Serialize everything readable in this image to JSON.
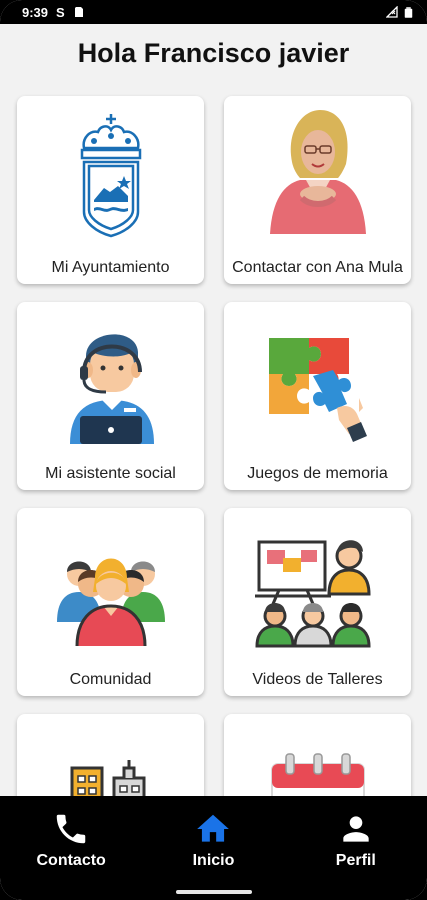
{
  "status_bar": {
    "time": "9:39",
    "s_glyph": "S"
  },
  "header": {
    "title": "Hola Francisco javier"
  },
  "cards": [
    {
      "label": "Mi Ayuntamiento",
      "icon": "coat-of-arms-icon"
    },
    {
      "label": "Contactar con Ana Mula",
      "icon": "ana-mula-photo"
    },
    {
      "label": "Mi asistente social",
      "icon": "social-assistant-icon"
    },
    {
      "label": "Juegos de memoria",
      "icon": "puzzle-icon"
    },
    {
      "label": "Comunidad",
      "icon": "community-icon"
    },
    {
      "label": "Videos de Talleres",
      "icon": "workshop-icon"
    },
    {
      "label": "",
      "icon": "buildings-icon"
    },
    {
      "label": "",
      "icon": "calendar-icon"
    }
  ],
  "bottom_nav": {
    "items": [
      {
        "label": "Contacto",
        "icon": "phone-icon"
      },
      {
        "label": "Inicio",
        "icon": "home-icon",
        "active": true
      },
      {
        "label": "Perfil",
        "icon": "person-icon"
      }
    ],
    "active_color": "#1a73e8"
  }
}
